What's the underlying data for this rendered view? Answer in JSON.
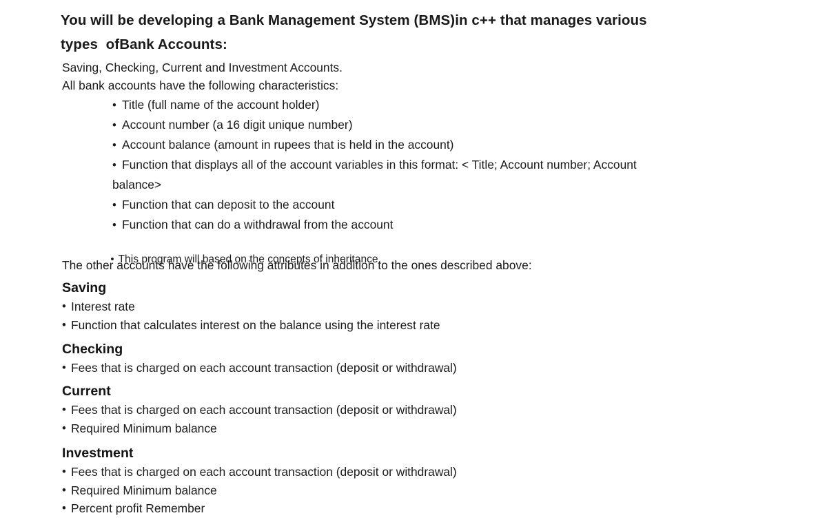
{
  "document": {
    "title_lines": [
      "You will be developing a Bank Management System (BMS)in c++ that manages various",
      "types  ofBank Accounts:"
    ],
    "intro_lines": [
      "Saving, Checking, Current and Investment Accounts.",
      "All bank accounts have the following characteristics:"
    ],
    "base_characteristics": [
      "Title (full name of the account holder)",
      "Account number (a 16 digit unique number)",
      "Account balance (amount in rupees that is held in the account)",
      "Function that displays all of the account variables in this format: < Title; Account number; Account balance>",
      "Function that can deposit to the account",
      "Function that can do a withdrawal from the account"
    ],
    "wrapped_item": {
      "first_segment": "Function that displays all of the account variables in this format: < Title; Account number; Account",
      "second_segment": "balance>"
    },
    "inheritance_note": "This program will based on the concepts of inheritance.",
    "other_accounts_line": "The other accounts have the following attributes in addition to the ones described above:",
    "sections": [
      {
        "heading": "Saving",
        "items": [
          "Interest rate",
          "Function that calculates interest on the balance using the interest rate"
        ]
      },
      {
        "heading": "Checking",
        "items": [
          "Fees that is charged on each account transaction (deposit or withdrawal)"
        ]
      },
      {
        "heading": "Current",
        "items": [
          "Fees that is charged on each account transaction (deposit or withdrawal)",
          "Required Minimum balance"
        ]
      },
      {
        "heading": "Investment",
        "items": [
          "Fees that is charged on each account transaction (deposit or withdrawal)",
          "Required Minimum balance",
          "Percent profit Remember"
        ]
      }
    ],
    "bullet_glyph": "•",
    "colors": {
      "background": "#ffffff",
      "text": "#1b1b1b",
      "heading": "#141414"
    }
  }
}
